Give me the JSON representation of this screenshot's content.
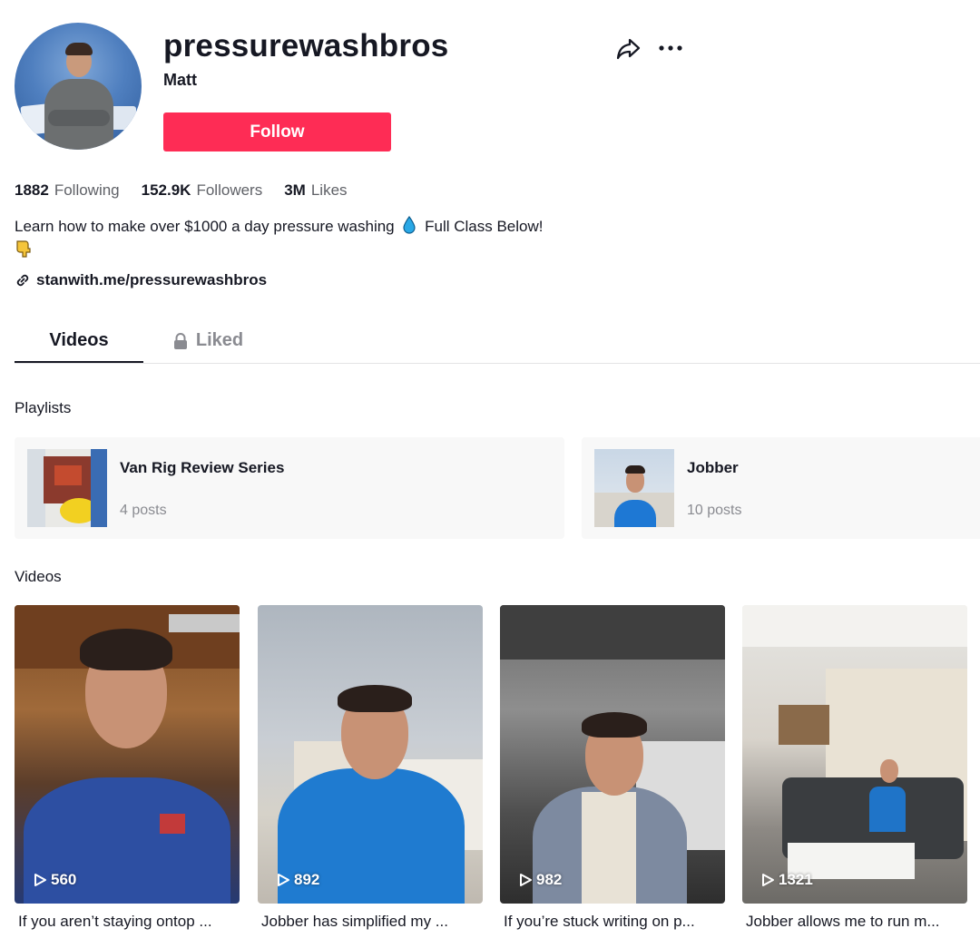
{
  "profile": {
    "username": "pressurewashbros",
    "nickname": "Matt",
    "follow_label": "Follow"
  },
  "stats": {
    "following_count": "1882",
    "following_label": "Following",
    "followers_count": "152.9K",
    "followers_label": "Followers",
    "likes_count": "3M",
    "likes_label": "Likes"
  },
  "bio": {
    "line1_a": "Learn how to make over $1000 a day pressure washing",
    "line1_b": "Full Class Below!",
    "link": "stanwith.me/pressurewashbros"
  },
  "tabs": [
    {
      "label": "Videos",
      "active": true
    },
    {
      "label": "Liked",
      "active": false,
      "locked": true
    }
  ],
  "playlists_title": "Playlists",
  "playlists": [
    {
      "name": "Van Rig Review Series",
      "count": "4 posts"
    },
    {
      "name": "Jobber",
      "count": "10 posts"
    }
  ],
  "videos_title": "Videos",
  "videos": [
    {
      "views": "560",
      "caption": "If you aren’t staying ontop ..."
    },
    {
      "views": "892",
      "caption": "Jobber has simplified my ..."
    },
    {
      "views": "982",
      "caption": "If you’re stuck writing on p..."
    },
    {
      "views": "1321",
      "caption": "Jobber allows me to run m..."
    }
  ],
  "colors": {
    "follow_bg": "#fe2c55",
    "text_primary": "#161823",
    "text_secondary": "#8a8b91",
    "playlist_bg": "#f8f8f8"
  },
  "icons": [
    "share-icon",
    "more-icon",
    "droplet-icon",
    "pointing-down-icon",
    "link-icon",
    "lock-icon",
    "play-icon"
  ]
}
